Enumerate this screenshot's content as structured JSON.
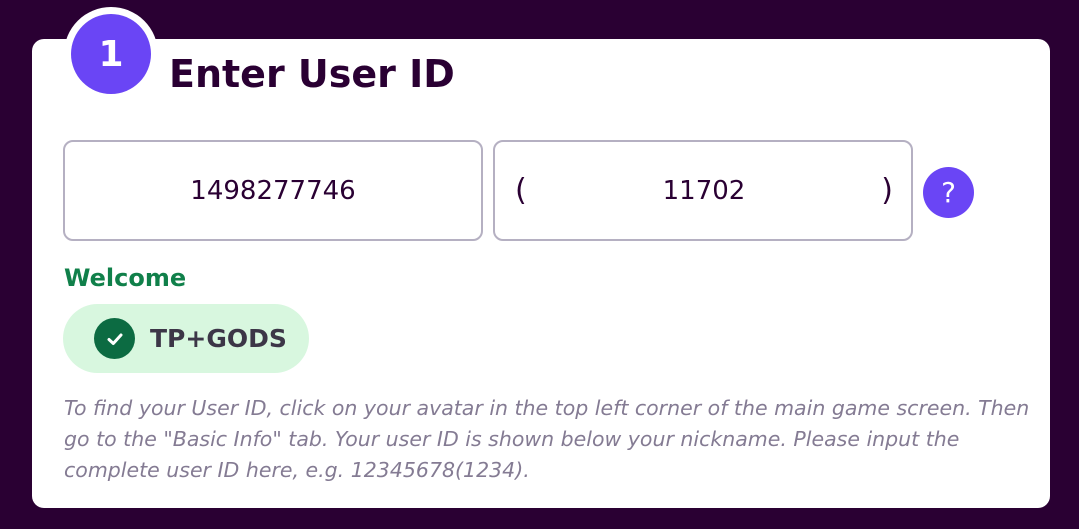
{
  "step": {
    "number": "1",
    "title": "Enter User ID"
  },
  "user_id": {
    "value": "1498277746"
  },
  "server_id": {
    "open_paren": "(",
    "value": "11702",
    "close_paren": ")"
  },
  "help_button": {
    "label": "?"
  },
  "welcome": {
    "label": "Welcome",
    "nickname": "TP+GODS"
  },
  "instructions": "To find your User ID, click on your avatar in the top left corner of the main game screen. Then go to the \"Basic Info\" tab. Your user ID is shown below your nickname. Please input the complete user ID here, e.g. 12345678(1234).",
  "colors": {
    "page_background": "#2a0033",
    "accent": "#6a45f5",
    "success": "#10804a",
    "success_bg": "#d8f7df"
  },
  "icons": {
    "check": "check-circle-icon",
    "help": "question-mark-icon"
  }
}
